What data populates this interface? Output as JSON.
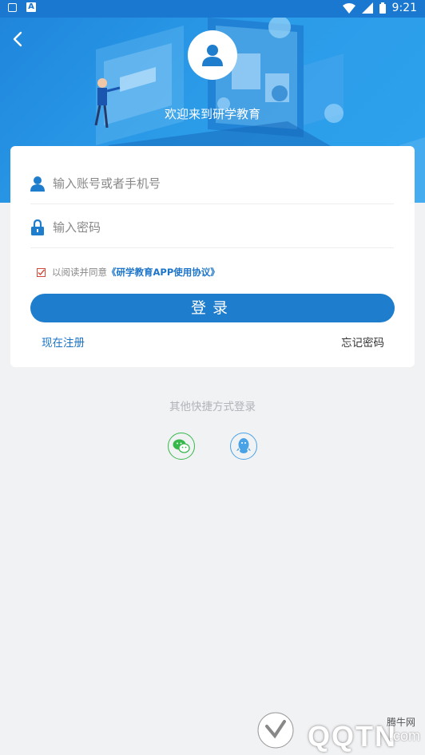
{
  "status_bar": {
    "time": "9:21",
    "left_icons": [
      "screenshot-icon",
      "app-a-icon"
    ],
    "right_icons": [
      "wifi-icon",
      "signal-icon",
      "battery-icon"
    ]
  },
  "header": {
    "back_icon": "chevron-left-icon",
    "avatar_icon": "user-icon",
    "welcome_text": "欢迎来到研学教育"
  },
  "login_form": {
    "account_placeholder": "输入账号或者手机号",
    "account_value": "",
    "password_placeholder": "输入密码",
    "password_value": "",
    "agreement_prefix": "以阅读并同意",
    "agreement_link": "《研学教育APP使用协议》",
    "agreement_checked": true,
    "login_button": "登录",
    "register_link": "现在注册",
    "forgot_link": "忘记密码"
  },
  "alt_login": {
    "title": "其他快捷方式登录",
    "options": [
      {
        "icon": "wechat-icon",
        "color": "#36b84b"
      },
      {
        "icon": "qq-icon",
        "color": "#4aa2e6"
      }
    ]
  },
  "watermark": {
    "brand": "QQTN",
    "domain": ".com",
    "chinese": "腾牛网"
  },
  "colors": {
    "primary": "#1e7dcc",
    "header_bg": "#2b9be8",
    "page_bg": "#f1f2f4"
  }
}
